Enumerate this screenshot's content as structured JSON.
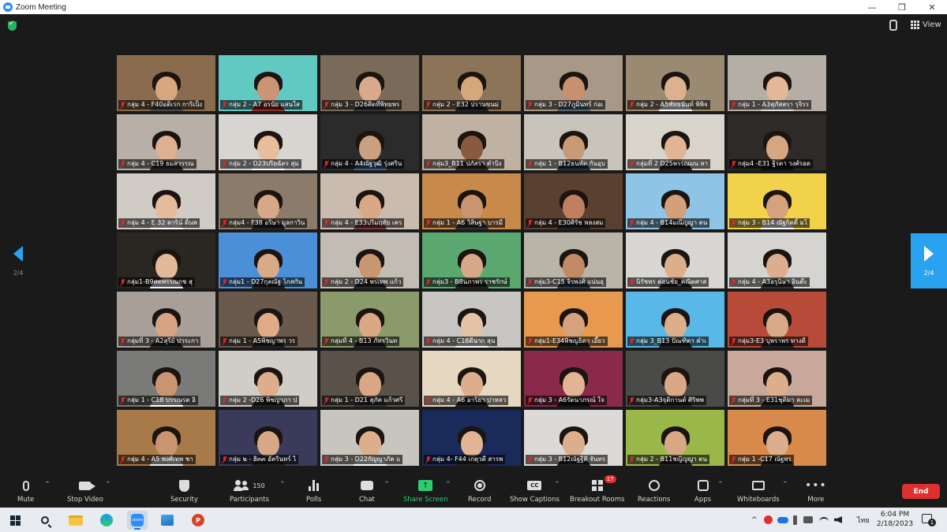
{
  "window": {
    "title": "Zoom Meeting",
    "minimize_glyph": "—",
    "restore_glyph": "❐",
    "close_glyph": "✕"
  },
  "topbar": {
    "security_status_icon": "shield-check-icon",
    "view_label": "View"
  },
  "gallery": {
    "page_indicator": "2/4",
    "participants": [
      {
        "name": "กลุ่ม 4 - F40อติเรก การิเป็ง",
        "bg": "#8a6b4e",
        "skin": "#d9a77f",
        "shirt": "#4a4a4a"
      },
      {
        "name": "กลุ่ม 2 - A7 อรนัย แสนใส",
        "bg": "#62c9c2",
        "skin": "#c99574",
        "shirt": "#8b2f2f"
      },
      {
        "name": "กลุ่ม 3 - D26ศิดที่พิทยพร",
        "bg": "#7a6a5a",
        "skin": "#d8a98a",
        "shirt": "#333333"
      },
      {
        "name": "กลุ่ม 2 - E32 ปรานขนม่",
        "bg": "#8b7458",
        "skin": "#d6a77d",
        "shirt": "#222222"
      },
      {
        "name": "กลุ่ม 3 - D27ภูมินทร์ ก่อเ",
        "bg": "#a89888",
        "skin": "#c89070",
        "shirt": "#556677"
      },
      {
        "name": "กลุ่ม 2 - A5พัทธนันท์ พิพิจ",
        "bg": "#9b8a72",
        "skin": "#ddb090",
        "shirt": "#ffffff"
      },
      {
        "name": "กลุ่ม 1 - A3สุภัสสรา รุจิรร",
        "bg": "#b5aea5",
        "skin": "#e2b898",
        "shirt": "#dddddd"
      },
      {
        "name": "กลุ่ม 4 - C19 ธมลวรรณ",
        "bg": "#b8b0a6",
        "skin": "#dcb090",
        "shirt": "#2a2a2a"
      },
      {
        "name": "กลุ่ม 2 - D23ปริยฉัตร สุม",
        "bg": "#d8d4cf",
        "skin": "#e6bd9d",
        "shirt": "#ffffff"
      },
      {
        "name": "กลุ่ม 4 - A4ณัฐวุฒิ รุ่งศริน",
        "bg": "#2b2b2b",
        "skin": "#caa080",
        "shirt": "#3a6090"
      },
      {
        "name": "กลุ่ม3_B11 ปภัสรา คำบิง",
        "bg": "#c0b2a2",
        "skin": "#8a5a40",
        "shirt": "#3a2a22"
      },
      {
        "name": "กลุ่ม 1 - B12ธนพัต กันอุบ",
        "bg": "#c8c4bc",
        "skin": "#c99a78",
        "shirt": "#223344"
      },
      {
        "name": "กลุ่มที่ 2 D25พรรณมน หา",
        "bg": "#d8d4cc",
        "skin": "#e0b494",
        "shirt": "#222222"
      },
      {
        "name": "กลุ่ม4 -E31 ฐิรดา วงศ์รอด",
        "bg": "#2e2a28",
        "skin": "#d6a680",
        "shirt": "#111111"
      },
      {
        "name": "กลุ่ม 4 - E 32 ดาริน์ ดิ้นพ",
        "bg": "#d0ccc5",
        "skin": "#e4bc9c",
        "shirt": "#ffffff"
      },
      {
        "name": "กลุ่ม4 - F38 อริษา มูลกาวิน",
        "bg": "#8b7b6b",
        "skin": "#d6a888",
        "shirt": "#222222"
      },
      {
        "name": "กลุ่ม 4 - E33ปริมฤทัย เคร",
        "bg": "#c9bcae",
        "skin": "#dba886",
        "shirt": "#7a3a3a"
      },
      {
        "name": "กลุ่ม 1 - A6 วิสิษฐา บารมี",
        "bg": "#c88a4a",
        "skin": "#c99470",
        "shirt": "#333333"
      },
      {
        "name": "กลุ่ม 4 - E30ศิรัช หลงสม",
        "bg": "#5a4030",
        "skin": "#c08060",
        "shirt": "#222222"
      },
      {
        "name": "กลุ่ม 4 - B14มณีญญา ตน",
        "bg": "#8ec4e6",
        "skin": "#d4a07a",
        "shirt": "#222222"
      },
      {
        "name": "กลุ่ม 3 - B14 ณัฐกิตติ์ มโ",
        "bg": "#f2d24a",
        "skin": "#d6a27e",
        "shirt": "#ffffff"
      },
      {
        "name": "กลุ่ม1-B9ศตพรรณกช สุ",
        "bg": "#2a2622",
        "skin": "#e2b898",
        "shirt": "#eeeeee"
      },
      {
        "name": "กลุ่ม1 - D27กุลณัฐ โกสกัน",
        "bg": "#4a8fd8",
        "skin": "#d8aa88",
        "shirt": "#222222"
      },
      {
        "name": "กลุ่ม 2 - D24 พรเทพ แก้ว",
        "bg": "#c2bdb4",
        "skin": "#c99672",
        "shirt": "#2a2a2a"
      },
      {
        "name": "กลุ่ม3 - B8นภาพร ราชรักษ์",
        "bg": "#5aa870",
        "skin": "#d6a888",
        "shirt": "#222222"
      },
      {
        "name": "กลุ่ม3-C15 จิรพงศ์ แน่นอุ",
        "bg": "#b8b4a8",
        "skin": "#c08a66",
        "shirt": "#2a3a4a"
      },
      {
        "name": "นิรัชพร ต่อนชัย_คณิตศาส",
        "bg": "#d8d6d2",
        "skin": "#dcae8c",
        "shirt": "#222222"
      },
      {
        "name": "กลุ่ม 4 - A3อรุนิษา อินต๊ะ",
        "bg": "#d6d4d0",
        "skin": "#dcae8e",
        "shirt": "#333333"
      },
      {
        "name": "กลุ่มที่ 3 - A2สุรีย์ ปาระกา",
        "bg": "#a8a098",
        "skin": "#d6a482",
        "shirt": "#222222"
      },
      {
        "name": "กลุ่ม 1 - A5พิชญาพร วร",
        "bg": "#6a5a4e",
        "skin": "#e0ac88",
        "shirt": "#222222"
      },
      {
        "name": "กลุ่มที่ 4 - B13 ภัทรวินท",
        "bg": "#8a9a6a",
        "skin": "#dba886",
        "shirt": "#222222"
      },
      {
        "name": "กลุ่ม 4 - C18ดีนาก ลุน",
        "bg": "#c8c6c2",
        "skin": "#e6c2a4",
        "shirt": "#ffffff"
      },
      {
        "name": "กลุ่ม1-E34พิชญธิดา เอี๊ยว",
        "bg": "#e79a4e",
        "skin": "#d6a27e",
        "shirt": "#222222"
      },
      {
        "name": "กลุ่ม 3_B13 ปัณฑิตา คำเ",
        "bg": "#58b8e8",
        "skin": "#dcae8c",
        "shirt": "#222222"
      },
      {
        "name": "กลุ่ม3-E3 บุพราพร ทางดี",
        "bg": "#b84a3a",
        "skin": "#d8aa88",
        "shirt": "#222222"
      },
      {
        "name": "กลุ่ม 1 - C18 บรรณรต อิ",
        "bg": "#7a7a78",
        "skin": "#c99470",
        "shirt": "#ffffff"
      },
      {
        "name": "กลุ่ม 2 -D26 พิชญาภา ป",
        "bg": "#d0ccc6",
        "skin": "#dcae8e",
        "shirt": "#222222"
      },
      {
        "name": "กลุ่ม 1 - D21 สุภัค แก้วศรี",
        "bg": "#5a5248",
        "skin": "#d8a886",
        "shirt": "#333333"
      },
      {
        "name": "กลุ่ม 4 - A6 อาริยา ปาหลว",
        "bg": "#e6d8c0",
        "skin": "#dcae8c",
        "shirt": "#222222"
      },
      {
        "name": "กลุ่ม 3 - A6รัตนาภรณ์ ใจ",
        "bg": "#8a2a4a",
        "skin": "#e2b494",
        "shirt": "#111111"
      },
      {
        "name": "กลุ่ม3-A3จุติกานต์ ศิริพพ",
        "bg": "#4a4a48",
        "skin": "#dba886",
        "shirt": "#222222"
      },
      {
        "name": "กลุ่มที่ 3 - E31ชุติมา ละเม",
        "bg": "#c8a89a",
        "skin": "#dcae8c",
        "shirt": "#222222"
      },
      {
        "name": "กลุ่ม 4 - A5 พงศ์เทพ ชา",
        "bg": "#a87a4a",
        "skin": "#c99470",
        "shirt": "#eeeeee"
      },
      {
        "name": "กลุ่ม ๒ - ฮิ๓๓ อัครินทร์ ไ",
        "bg": "#3a3a5a",
        "skin": "#d8a886",
        "shirt": "#222222"
      },
      {
        "name": "กลุ่ม 3 - D22กัญญาภัค แ",
        "bg": "#c8c4be",
        "skin": "#dcae8c",
        "shirt": "#ffffff"
      },
      {
        "name": "กลุ่ม 4- F44 เกตุวดี สารพ",
        "bg": "#1a2a5a",
        "skin": "#e0b494",
        "shirt": "#222222"
      },
      {
        "name": "กลุ่ม 3 - B12ณัฐฐิติ จันทร",
        "bg": "#dcdad6",
        "skin": "#dcae8c",
        "shirt": "#222222"
      },
      {
        "name": "กลุ่ม 2 - B11ชญิญญา ตน",
        "bg": "#9ab84a",
        "skin": "#d8a886",
        "shirt": "#222222"
      },
      {
        "name": "กลุ่ม 1 -C17 ณัฐพร",
        "bg": "#d88a4a",
        "skin": "#dcae8c",
        "shirt": "#222222"
      }
    ]
  },
  "toolbar": {
    "mute": "Mute",
    "stop_video": "Stop Video",
    "security": "Security",
    "participants": "Participants",
    "participants_count": "150",
    "polls": "Polls",
    "chat": "Chat",
    "share_screen": "Share Screen",
    "record": "Record",
    "show_captions": "Show Captions",
    "cc_glyph": "CC",
    "breakout_rooms": "Breakout Rooms",
    "breakout_badge": "17",
    "reactions": "Reactions",
    "apps": "Apps",
    "whiteboards": "Whiteboards",
    "more": "More",
    "end": "End",
    "caret": "^",
    "share_glyph": "↑",
    "more_glyph": "•••"
  },
  "taskbar": {
    "zoom_app_label": "zoom",
    "ppt_label": "P",
    "tray_caret": "^",
    "language": "ไทย",
    "time": "6:04 PM",
    "date": "2/18/2023",
    "notification_count": "1"
  },
  "colors": {
    "accent_blue": "#2d8cff",
    "end_red": "#e02f2f",
    "share_green": "#2ecc71",
    "pager_blue": "#29a3ef"
  }
}
